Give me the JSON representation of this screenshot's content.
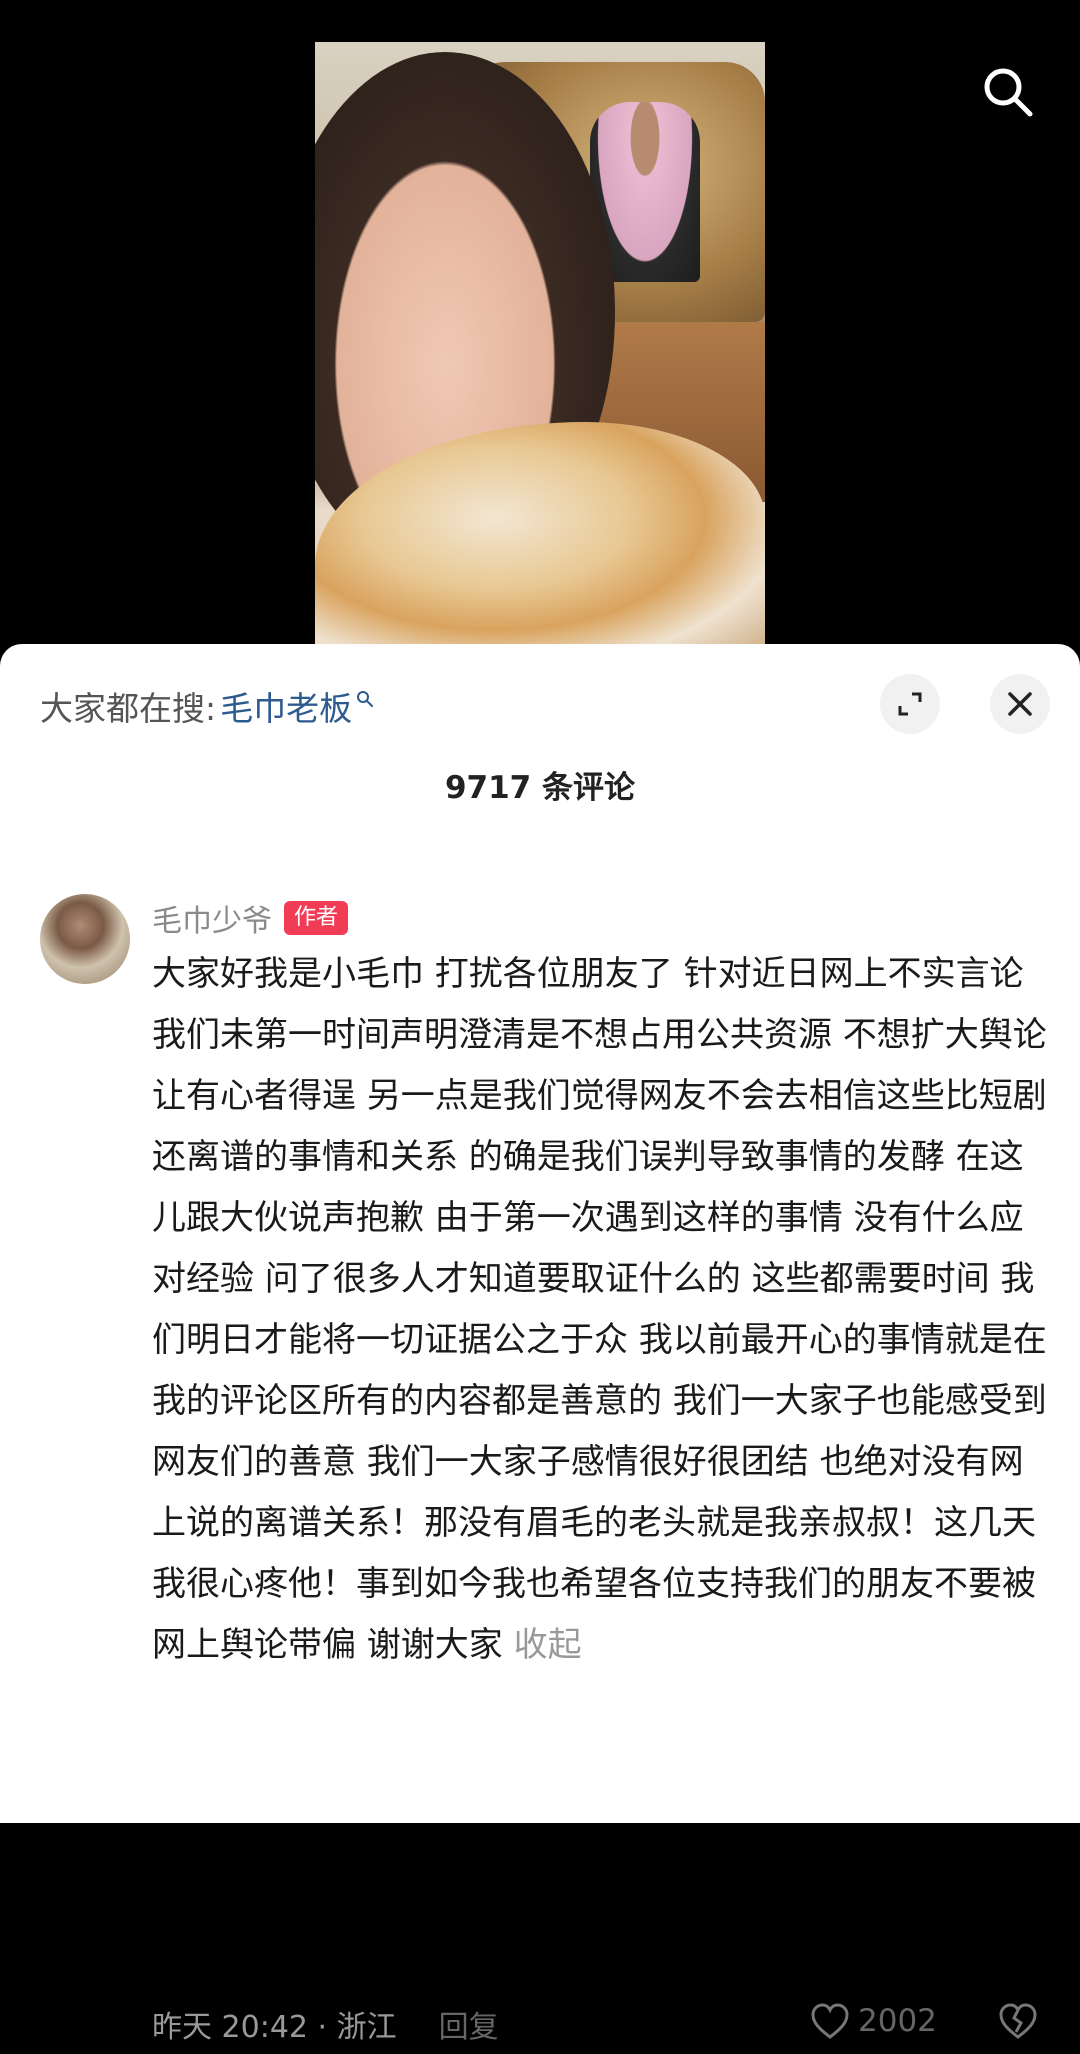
{
  "search": {
    "icon": "search-icon"
  },
  "sheet": {
    "trending_prefix": "大家都在搜:",
    "trending_keyword": "毛巾老板",
    "comment_count": "9717 条评论"
  },
  "comment": {
    "author": "毛巾少爷",
    "badge": "作者",
    "text": "大家好我是小毛巾 打扰各位朋友了 针对近日网上不实言论 我们未第一时间声明澄清是不想占用公共资源 不想扩大舆论 让有心者得逞 另一点是我们觉得网友不会去相信这些比短剧还离谱的事情和关系 的确是我们误判导致事情的发酵 在这儿跟大伙说声抱歉  由于第一次遇到这样的事情 没有什么应对经验 问了很多人才知道要取证什么的 这些都需要时间 我们明日才能将一切证据公之于众 我以前最开心的事情就是在我的评论区所有的内容都是善意的 我们一大家子也能感受到网友们的善意 我们一大家子感情很好很团结 也绝对没有网上说的离谱关系！那没有眉毛的老头就是我亲叔叔！这几天我很心疼他！事到如今我也希望各位支持我们的朋友不要被网上舆论带偏 谢谢大家",
    "collapse_label": "收起",
    "timestamp": "昨天 20:42 · 浙江",
    "reply_label": "回复",
    "likes": "2002"
  }
}
